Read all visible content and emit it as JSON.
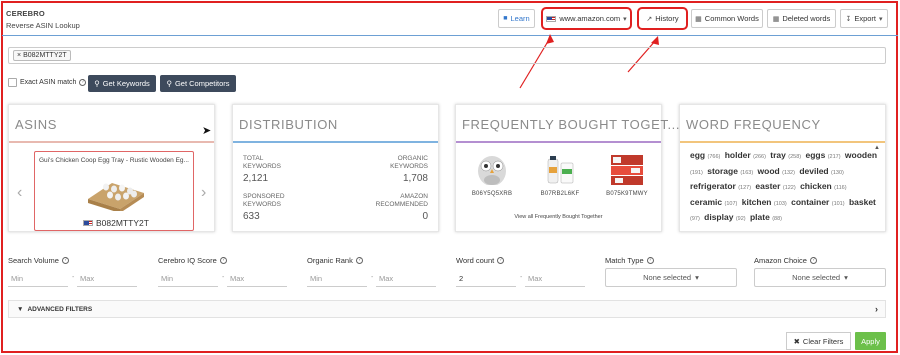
{
  "brand": {
    "name": "CEREBRO",
    "subtitle": "Reverse ASIN Lookup"
  },
  "header": {
    "learn": "Learn",
    "marketplace": "www.amazon.com",
    "history": "History",
    "common_words": "Common Words",
    "deleted_words": "Deleted words",
    "export": "Export"
  },
  "search": {
    "tag": "B082MTTY2T",
    "tag_remove": "×"
  },
  "options": {
    "exact_match": "Exact ASIN match",
    "get_keywords": "Get Keywords",
    "get_competitors": "Get Competitors"
  },
  "cards": {
    "asins": {
      "title": "ASINS",
      "product_title": "Gui's Chicken Coop Egg Tray - Rustic Wooden Eg...",
      "asin": "B082MTTY2T"
    },
    "distribution": {
      "title": "DISTRIBUTION",
      "total_label_1": "TOTAL",
      "total_label_2": "KEYWORDS",
      "total_value": "2,121",
      "organic_label_1": "ORGANIC",
      "organic_label_2": "KEYWORDS",
      "organic_value": "1,708",
      "sponsored_label_1": "SPONSORED",
      "sponsored_label_2": "KEYWORDS",
      "sponsored_value": "633",
      "recommended_label_1": "AMAZON",
      "recommended_label_2": "RECOMMENDED",
      "recommended_value": "0"
    },
    "fbt": {
      "title": "FREQUENTLY BOUGHT TOGET...",
      "items": [
        "B06Y5Q5XRB",
        "B07RB2L6KF",
        "B075K9TMWY"
      ],
      "view_all": "View all Frequently Bought Together"
    },
    "word_frequency": {
      "title": "WORD FREQUENCY",
      "words": [
        {
          "w": "egg",
          "n": "(766)"
        },
        {
          "w": "holder",
          "n": "(266)"
        },
        {
          "w": "tray",
          "n": "(258)"
        },
        {
          "w": "eggs",
          "n": "(217)"
        },
        {
          "w": "wooden",
          "n": "(191)"
        },
        {
          "w": "storage",
          "n": "(163)"
        },
        {
          "w": "wood",
          "n": "(132)"
        },
        {
          "w": "deviled",
          "n": "(130)"
        },
        {
          "w": "refrigerator",
          "n": "(127)"
        },
        {
          "w": "easter",
          "n": "(122)"
        },
        {
          "w": "chicken",
          "n": "(116)"
        },
        {
          "w": "ceramic",
          "n": "(107)"
        },
        {
          "w": "kitchen",
          "n": "(103)"
        },
        {
          "w": "container",
          "n": "(101)"
        },
        {
          "w": "basket",
          "n": "(97)"
        },
        {
          "w": "display",
          "n": "(92)"
        },
        {
          "w": "plate",
          "n": "(88)"
        }
      ]
    }
  },
  "filters": {
    "search_volume": "Search Volume",
    "cerebro_iq": "Cerebro IQ Score",
    "organic_rank": "Organic Rank",
    "word_count": "Word count",
    "match_type": "Match Type",
    "amazon_choice": "Amazon Choice",
    "min": "Min",
    "max": "Max",
    "word_count_min_value": "2",
    "none_selected": "None selected",
    "range_dash": "-",
    "advanced": "ADVANCED FILTERS",
    "clear": "Clear Filters",
    "apply": "Apply"
  },
  "colors": {
    "asins_rule": "#e8b9b0",
    "distribution_rule": "#7fb3e0",
    "fbt_rule": "#b48fd1",
    "word_rule": "#f2c57c",
    "highlight": "#e02020",
    "apply": "#6cc04a",
    "dark_button": "#3d4a5c"
  }
}
